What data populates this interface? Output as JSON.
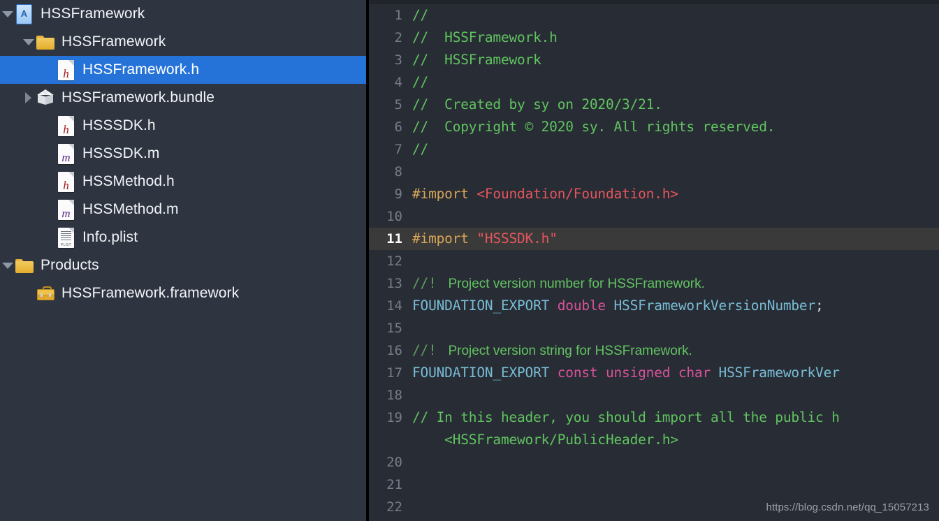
{
  "navigator": {
    "rows": [
      {
        "label": "HSSFramework",
        "icon": "xcode-project-icon",
        "twisty": "open",
        "indent": 22,
        "selected": false
      },
      {
        "label": "HSSFramework",
        "icon": "folder-icon",
        "twisty": "open",
        "indent": 52,
        "selected": false
      },
      {
        "label": "HSSFramework.h",
        "icon": "header-file-icon",
        "twisty": "none",
        "indent": 82,
        "selected": true
      },
      {
        "label": "HSSFramework.bundle",
        "icon": "bundle-icon",
        "twisty": "closed",
        "indent": 52,
        "selected": false
      },
      {
        "label": "HSSSDK.h",
        "icon": "header-file-icon",
        "twisty": "none",
        "indent": 82,
        "selected": false
      },
      {
        "label": "HSSSDK.m",
        "icon": "source-file-icon",
        "twisty": "none",
        "indent": 82,
        "selected": false
      },
      {
        "label": "HSSMethod.h",
        "icon": "header-file-icon",
        "twisty": "none",
        "indent": 82,
        "selected": false
      },
      {
        "label": "HSSMethod.m",
        "icon": "source-file-icon",
        "twisty": "none",
        "indent": 82,
        "selected": false
      },
      {
        "label": "Info.plist",
        "icon": "plist-file-icon",
        "twisty": "none",
        "indent": 82,
        "selected": false
      },
      {
        "label": "Products",
        "icon": "folder-icon",
        "twisty": "open",
        "indent": 22,
        "selected": false
      },
      {
        "label": "HSSFramework.framework",
        "icon": "framework-icon",
        "twisty": "none",
        "indent": 52,
        "selected": false
      }
    ]
  },
  "editor": {
    "filename": "HSSFramework.h",
    "current_line": 11,
    "lines": [
      {
        "num": "1",
        "tokens": [
          {
            "t": "//",
            "c": "t-comment"
          }
        ]
      },
      {
        "num": "2",
        "tokens": [
          {
            "t": "//  HSSFramework.h",
            "c": "t-comment"
          }
        ]
      },
      {
        "num": "3",
        "tokens": [
          {
            "t": "//  HSSFramework",
            "c": "t-comment"
          }
        ]
      },
      {
        "num": "4",
        "tokens": [
          {
            "t": "//",
            "c": "t-comment"
          }
        ]
      },
      {
        "num": "5",
        "tokens": [
          {
            "t": "//  Created by sy on 2020/3/21.",
            "c": "t-comment"
          }
        ]
      },
      {
        "num": "6",
        "tokens": [
          {
            "t": "//  Copyright © 2020 sy. All rights reserved.",
            "c": "t-comment"
          }
        ]
      },
      {
        "num": "7",
        "tokens": [
          {
            "t": "//",
            "c": "t-comment"
          }
        ]
      },
      {
        "num": "8",
        "tokens": []
      },
      {
        "num": "9",
        "tokens": [
          {
            "t": "#import ",
            "c": "t-pre"
          },
          {
            "t": "<Foundation/Foundation.h>",
            "c": "t-string"
          }
        ]
      },
      {
        "num": "10",
        "tokens": []
      },
      {
        "num": "11",
        "tokens": [
          {
            "t": "#import ",
            "c": "t-pre"
          },
          {
            "t": "\"HSSSDK.h\"",
            "c": "t-string"
          }
        ]
      },
      {
        "num": "12",
        "tokens": []
      },
      {
        "num": "13",
        "tokens": [
          {
            "t": "//! ",
            "c": "t-docmark"
          },
          {
            "t": " Project version number for HSSFramework.",
            "c": "t-doctext"
          }
        ]
      },
      {
        "num": "14",
        "tokens": [
          {
            "t": "FOUNDATION_EXPORT ",
            "c": "t-type"
          },
          {
            "t": "double ",
            "c": "t-keyword"
          },
          {
            "t": "HSSFrameworkVersionNumber",
            "c": "t-ident"
          },
          {
            "t": ";",
            "c": "t-punct"
          }
        ]
      },
      {
        "num": "15",
        "tokens": []
      },
      {
        "num": "16",
        "tokens": [
          {
            "t": "//! ",
            "c": "t-docmark"
          },
          {
            "t": " Project version string for HSSFramework.",
            "c": "t-doctext"
          }
        ]
      },
      {
        "num": "17",
        "tokens": [
          {
            "t": "FOUNDATION_EXPORT ",
            "c": "t-type"
          },
          {
            "t": "const unsigned char ",
            "c": "t-keyword"
          },
          {
            "t": "HSSFrameworkVer",
            "c": "t-ident"
          }
        ]
      },
      {
        "num": "18",
        "tokens": []
      },
      {
        "num": "19",
        "tokens": [
          {
            "t": "// In this header, you should import all the public h",
            "c": "t-comment"
          }
        ]
      },
      {
        "num": "",
        "tokens": [
          {
            "t": "    <HSSFramework/PublicHeader.h>",
            "c": "t-comment"
          }
        ]
      },
      {
        "num": "20",
        "tokens": []
      },
      {
        "num": "21",
        "tokens": []
      },
      {
        "num": "22",
        "tokens": []
      }
    ]
  },
  "watermark": {
    "text": "https://blog.csdn.net/qq_15057213"
  },
  "colors": {
    "sidebar_bg": "#2e3440",
    "selection_blue": "#2573d8",
    "editor_bg": "#282c34",
    "current_line_bg": "#3a3a3a",
    "comment_green": "#60c460",
    "string_red": "#e4565d",
    "preprocessor_tan": "#d8a657",
    "keyword_pink": "#d6539b",
    "type_blue": "#78bcd6"
  }
}
